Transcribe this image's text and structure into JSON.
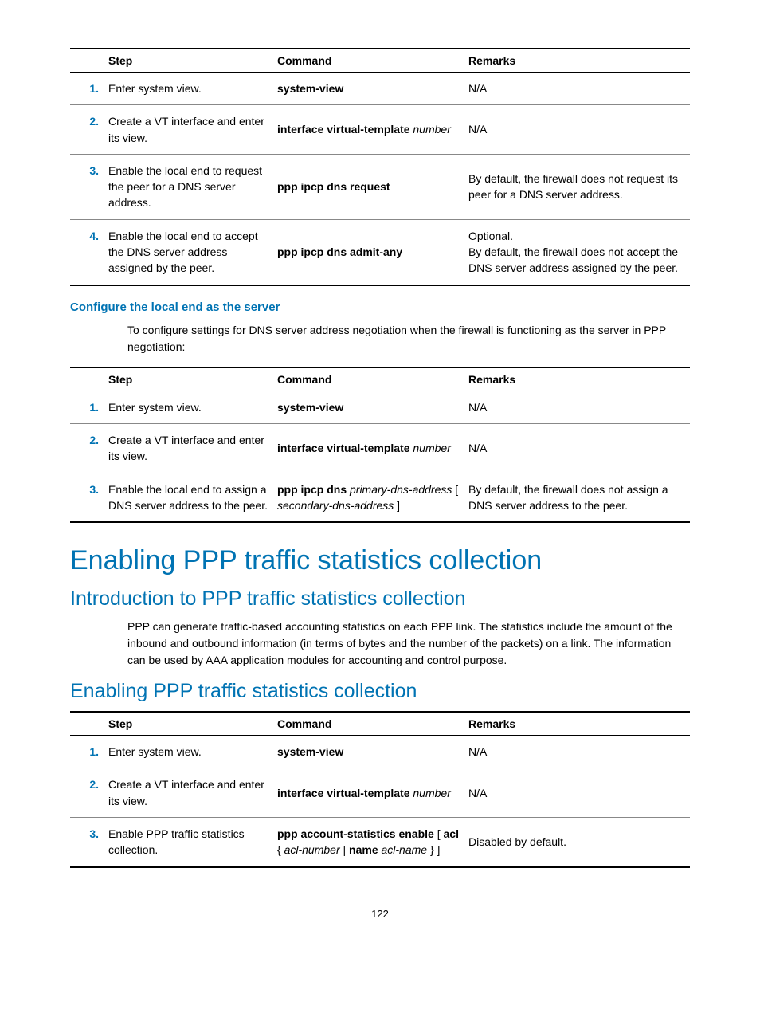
{
  "header_step": "Step",
  "header_command": "Command",
  "header_remarks": "Remarks",
  "table1": [
    {
      "num": "1.",
      "step": "Enter system view.",
      "cmd": "<strong>system-view</strong>",
      "rem": "N/A"
    },
    {
      "num": "2.",
      "step": "Create a VT interface and enter its view.",
      "cmd": "<strong>interface virtual-template</strong> <em>number</em>",
      "rem": "N/A"
    },
    {
      "num": "3.",
      "step": "Enable the local end to request the peer for a DNS server address.",
      "cmd": "<strong>ppp ipcp dns request</strong>",
      "rem": "By default, the firewall does not request its peer for a DNS server address."
    },
    {
      "num": "4.",
      "step": "Enable the local end to accept the DNS server address assigned by the peer.",
      "cmd": "<strong>ppp ipcp dns admit-any</strong>",
      "rem": "Optional.<br>By default, the firewall does not accept the DNS server address assigned by the peer."
    }
  ],
  "h3_server": "Configure the local end as the server",
  "para_server": "To configure settings for DNS server address negotiation when the firewall is functioning as the server in PPP negotiation:",
  "table2": [
    {
      "num": "1.",
      "step": "Enter system view.",
      "cmd": "<strong>system-view</strong>",
      "rem": "N/A"
    },
    {
      "num": "2.",
      "step": "Create a VT interface and enter its view.",
      "cmd": "<strong>interface virtual-template</strong> <em>number</em>",
      "rem": "N/A"
    },
    {
      "num": "3.",
      "step": "Enable the local end to assign a DNS server address to the peer.",
      "cmd": "<strong>ppp ipcp dns</strong> <em>primary-dns-address</em> [ <em>secondary-dns-address</em> ]",
      "rem": "By default, the firewall does not assign a DNS server address to the peer."
    }
  ],
  "h1_enabling": "Enabling PPP traffic statistics collection",
  "h2_intro": "Introduction to PPP traffic statistics collection",
  "para_intro": "PPP can generate traffic-based accounting statistics on each PPP link. The statistics include the amount of the inbound and outbound information (in terms of bytes and the number of the packets) on a link. The information can be used by AAA application modules for accounting and control purpose.",
  "h2_enabling": "Enabling PPP traffic statistics collection",
  "table3": [
    {
      "num": "1.",
      "step": "Enter system view.",
      "cmd": "<strong>system-view</strong>",
      "rem": "N/A"
    },
    {
      "num": "2.",
      "step": "Create a VT interface and enter its view.",
      "cmd": "<strong>interface virtual-template</strong> <em>number</em>",
      "rem": "N/A"
    },
    {
      "num": "3.",
      "step": "Enable PPP traffic statistics collection.",
      "cmd": "<strong>ppp account-statistics enable</strong> [ <strong>acl</strong> { <em>acl-number</em> | <strong>name</strong> <em>acl-name</em> } ]",
      "rem": "Disabled by default."
    }
  ],
  "pagenum": "122"
}
